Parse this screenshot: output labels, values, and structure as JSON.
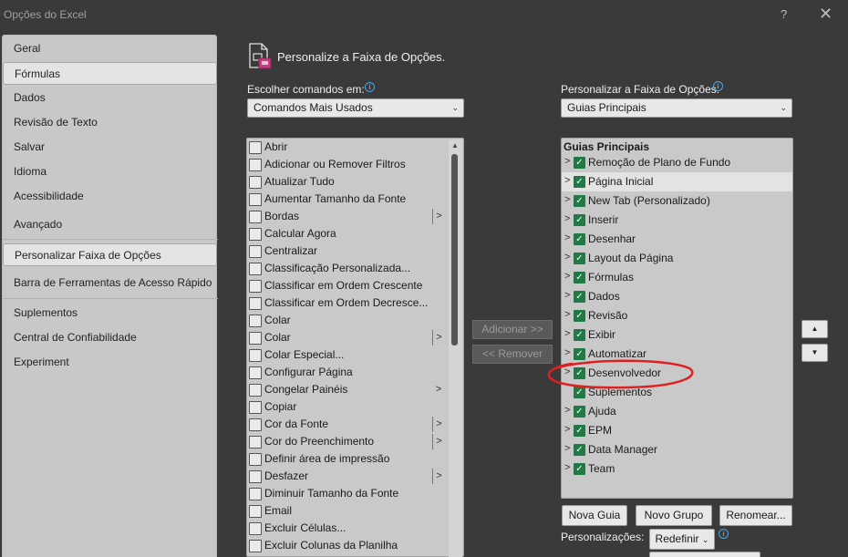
{
  "window": {
    "title": "Opções do Excel",
    "help": "?",
    "close": "✕"
  },
  "sidebar": {
    "items": [
      {
        "label": "Geral"
      },
      {
        "label": "Fórmulas",
        "selected": true
      },
      {
        "label": "Dados"
      },
      {
        "label": "Revisão de Texto"
      },
      {
        "label": "Salvar"
      },
      {
        "label": "Idioma"
      },
      {
        "label": "Acessibilidade"
      },
      {
        "label": "Avançado"
      },
      {
        "label": "Personalizar Faixa de Opções",
        "selected": true
      },
      {
        "label": "Barra de Ferramentas de Acesso Rápido"
      },
      {
        "label": "Suplementos"
      },
      {
        "label": "Central de Confiabilidade"
      },
      {
        "label": "Experiment"
      }
    ]
  },
  "main": {
    "heading": "Personalize a Faixa de Opções.",
    "choose_label": "Escolher comandos em:",
    "choose_value": "Comandos Mais Usados",
    "customize_label": "Personalizar a Faixa de Opções:",
    "customize_value": "Guias Principais",
    "commands": [
      {
        "label": "Abrir",
        "icon": "folder-open-icon"
      },
      {
        "label": "Adicionar ou Remover Filtros",
        "icon": "filter-icon"
      },
      {
        "label": "Atualizar Tudo",
        "icon": "refresh-icon"
      },
      {
        "label": "Aumentar Tamanho da Fonte",
        "icon": "font-grow-icon"
      },
      {
        "label": "Bordas",
        "icon": "borders-icon",
        "submenu": "|>"
      },
      {
        "label": "Calcular Agora",
        "icon": "calculator-icon"
      },
      {
        "label": "Centralizar",
        "icon": "align-center-icon"
      },
      {
        "label": "Classificação Personalizada...",
        "icon": "sort-custom-icon"
      },
      {
        "label": "Classificar em Ordem Crescente",
        "icon": "sort-ascending-icon"
      },
      {
        "label": "Classificar em Ordem Decresce...",
        "icon": "sort-descending-icon"
      },
      {
        "label": "Colar",
        "icon": "paste-icon"
      },
      {
        "label": "Colar",
        "icon": "paste-icon",
        "submenu": "|>"
      },
      {
        "label": "Colar Especial...",
        "icon": "paste-special-icon"
      },
      {
        "label": "Configurar Página",
        "icon": "page-setup-icon"
      },
      {
        "label": "Congelar Painéis",
        "icon": "freeze-panes-icon",
        "submenu": ">"
      },
      {
        "label": "Copiar",
        "icon": "copy-icon"
      },
      {
        "label": "Cor da Fonte",
        "icon": "font-color-icon",
        "submenu": "|>"
      },
      {
        "label": "Cor do Preenchimento",
        "icon": "fill-color-icon",
        "submenu": "|>"
      },
      {
        "label": "Definir área de impressão",
        "icon": "print-area-icon"
      },
      {
        "label": "Desfazer",
        "icon": "undo-icon",
        "submenu": "|>"
      },
      {
        "label": "Diminuir Tamanho da Fonte",
        "icon": "font-shrink-icon"
      },
      {
        "label": "Email",
        "icon": "email-icon"
      },
      {
        "label": "Excluir Células...",
        "icon": "delete-cells-icon"
      },
      {
        "label": "Excluir Colunas da Planilha",
        "icon": "delete-columns-icon"
      }
    ],
    "add_button": "Adicionar >>",
    "remove_button": "<< Remover",
    "tree_header": "Guias Principais",
    "tabs": [
      {
        "label": "Remoção de Plano de Fundo",
        "expander": true
      },
      {
        "label": "Página Inicial",
        "expander": true,
        "selected": true
      },
      {
        "label": "New Tab (Personalizado)",
        "expander": true
      },
      {
        "label": "Inserir",
        "expander": true
      },
      {
        "label": "Desenhar",
        "expander": true
      },
      {
        "label": "Layout da Página",
        "expander": true
      },
      {
        "label": "Fórmulas",
        "expander": true
      },
      {
        "label": "Dados",
        "expander": true
      },
      {
        "label": "Revisão",
        "expander": true
      },
      {
        "label": "Exibir",
        "expander": true
      },
      {
        "label": "Automatizar",
        "expander": true
      },
      {
        "label": "Desenvolvedor",
        "expander": true
      },
      {
        "label": "Suplementos",
        "expander": false
      },
      {
        "label": "Ajuda",
        "expander": true
      },
      {
        "label": "EPM",
        "expander": true
      },
      {
        "label": "Data Manager",
        "expander": true
      },
      {
        "label": "Team",
        "expander": true
      }
    ],
    "move_up": "▲",
    "move_down": "▼",
    "new_tab_button": "Nova Guia",
    "new_group_button": "Novo Grupo",
    "rename_button": "Renomear...",
    "customizations_label": "Personalizações:",
    "reset_button": "Redefinir",
    "info": "i",
    "checkmark": "✓",
    "chevron": ">"
  },
  "colors": {
    "checkbox": "#1f7a45",
    "annotation": "#e02020",
    "info": "#4aa3e8"
  }
}
